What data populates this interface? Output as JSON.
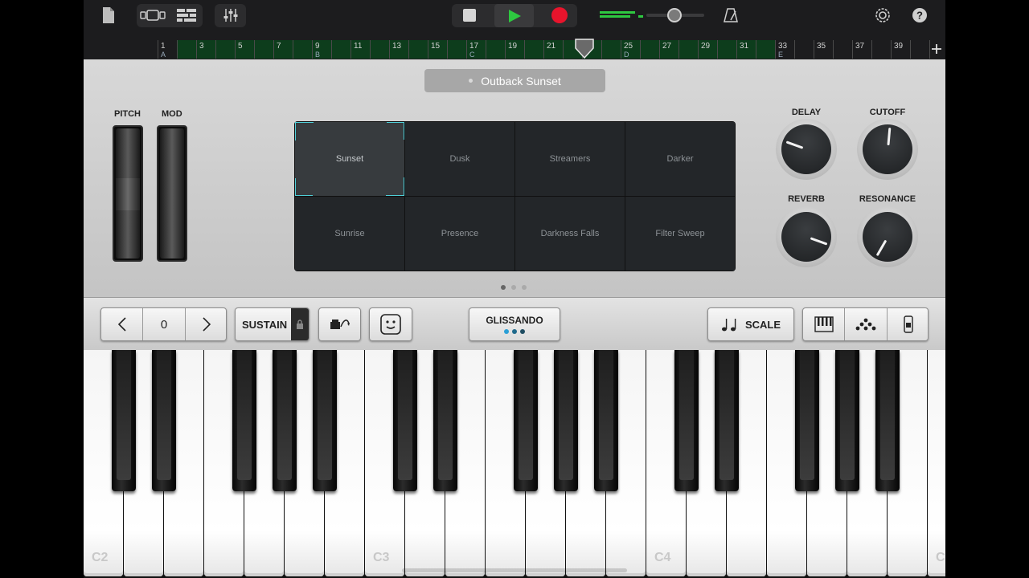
{
  "ruler": {
    "bars": [
      "1",
      "3",
      "5",
      "7",
      "9",
      "11",
      "13",
      "15",
      "17",
      "19",
      "21",
      "23",
      "25",
      "27",
      "29",
      "31",
      "33",
      "35",
      "37",
      "39"
    ],
    "sections": [
      "A",
      "B",
      "C",
      "D",
      "E"
    ]
  },
  "preset": {
    "name": "Outback Sunset"
  },
  "wheels": {
    "pitch_label": "PITCH",
    "mod_label": "MOD"
  },
  "pads": [
    "Sunset",
    "Dusk",
    "Streamers",
    "Darker",
    "Sunrise",
    "Presence",
    "Darkness Falls",
    "Filter Sweep"
  ],
  "knobs": {
    "delay": {
      "label": "DELAY",
      "angle_deg": -70
    },
    "cutoff": {
      "label": "CUTOFF",
      "angle_deg": 5
    },
    "reverb": {
      "label": "REVERB",
      "angle_deg": 110
    },
    "resonance": {
      "label": "RESONANCE",
      "angle_deg": 210
    }
  },
  "controls": {
    "octave_value": "0",
    "sustain": "SUSTAIN",
    "glissando": "GLISSANDO",
    "scale": "SCALE"
  },
  "keyboard": {
    "labels": [
      "C2",
      "C3",
      "C4",
      "C"
    ]
  },
  "colors": {
    "play": "#2ec840",
    "record": "#e8142c",
    "accent": "#4fd0d8",
    "ruler_green": "#0d3d1c"
  }
}
